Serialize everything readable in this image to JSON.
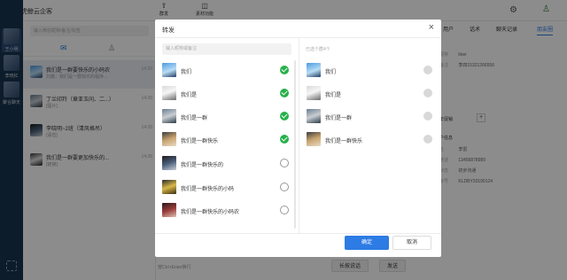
{
  "app": {
    "title": "虎鲸云企客"
  },
  "toolbar": {
    "item1_label": "群发",
    "item2_label": "素材功能"
  },
  "rail": {
    "items": [
      {
        "label": "王小明"
      },
      {
        "label": "李晓红"
      },
      {
        "label": "聚合聊天"
      }
    ]
  },
  "conversations": {
    "search_placeholder": "输入微信昵称/备注/标签",
    "items": [
      {
        "name": "我们是一群要快乐的小码农",
        "sub": "刘鑫：我们是一群快乐的程序...",
        "time": "14:26"
      },
      {
        "name": "丁兰印羚（章亚玉问、二...）",
        "sub": "[图片]",
        "time": "14:26"
      },
      {
        "name": "李晓明~2班（清风格吊）",
        "sub": "[语音]",
        "time": "14:26"
      },
      {
        "name": "我们是一群要更加快乐的...",
        "sub": "[链接]",
        "time": "14:26"
      }
    ]
  },
  "chat": {
    "hint": "按Ctrl+Enter换行",
    "long_button": "长按说话",
    "send_button": "发送"
  },
  "right_panel": {
    "tabs": [
      "用户",
      "话术",
      "聊天记录",
      "朋友圈"
    ],
    "fields": [
      {
        "label": "昵称",
        "value": "liner"
      },
      {
        "label": "备注",
        "value": "李四15321266556"
      }
    ],
    "tag": "年促销",
    "section": "户信息",
    "details": [
      {
        "label": "名",
        "value": "李雷"
      },
      {
        "label": "电话",
        "value": "13456878989"
      },
      {
        "label": "状态",
        "value": "初步沟通"
      },
      {
        "label": "单号",
        "value": "KLDBY20190124"
      }
    ],
    "add_label": "+"
  },
  "dialog": {
    "title": "转发",
    "close": "×",
    "search_placeholder": "输入昵称或备注",
    "selected_count": "已选个群4个",
    "ok": "确定",
    "cancel": "取消",
    "candidates": [
      {
        "name": "我们",
        "checked": true,
        "avatar": "av1"
      },
      {
        "name": "我们是",
        "checked": true,
        "avatar": "av2"
      },
      {
        "name": "我们是一群",
        "checked": true,
        "avatar": "av3"
      },
      {
        "name": "我们是一群快乐",
        "checked": true,
        "avatar": "av4"
      },
      {
        "name": "我们是一群快乐的",
        "checked": false,
        "avatar": "av5"
      },
      {
        "name": "我们是一群快乐的小码",
        "checked": false,
        "avatar": "av6"
      },
      {
        "name": "我们是一群快乐的小码农",
        "checked": false,
        "avatar": "av7"
      }
    ],
    "selected": [
      {
        "name": "我们",
        "avatar": "av1"
      },
      {
        "name": "我们是",
        "avatar": "av2"
      },
      {
        "name": "我们是一群",
        "avatar": "av3"
      },
      {
        "name": "我们是一群快乐",
        "avatar": "av4"
      }
    ]
  }
}
